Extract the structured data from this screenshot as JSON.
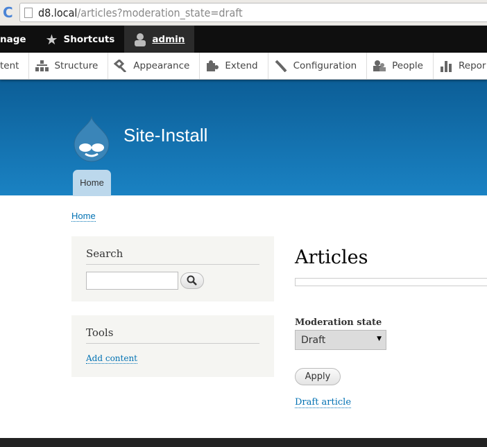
{
  "browser": {
    "url_host": "d8.local",
    "url_path": "/articles?moderation_state=draft"
  },
  "toolbar": {
    "manage": "nage",
    "shortcuts": "Shortcuts",
    "user": "admin"
  },
  "admin_menu": [
    {
      "label": "tent",
      "icon": "content-icon"
    },
    {
      "label": "Structure",
      "icon": "structure-icon"
    },
    {
      "label": "Appearance",
      "icon": "appearance-icon"
    },
    {
      "label": "Extend",
      "icon": "extend-icon"
    },
    {
      "label": "Configuration",
      "icon": "wrench-icon"
    },
    {
      "label": "People",
      "icon": "people-icon"
    },
    {
      "label": "Repor",
      "icon": "reports-icon"
    }
  ],
  "header": {
    "site_name": "Site-Install",
    "tab_home": "Home"
  },
  "breadcrumb": "Home",
  "sidebar": {
    "search_title": "Search",
    "tools_title": "Tools",
    "add_content": "Add content"
  },
  "main": {
    "title": "Articles",
    "filter_label": "Moderation state",
    "filter_value": "Draft",
    "apply": "Apply",
    "result_link": "Draft article"
  },
  "colors": {
    "link": "#0071b3",
    "header_top": "#0c5e97",
    "header_bottom": "#1a82c3"
  }
}
